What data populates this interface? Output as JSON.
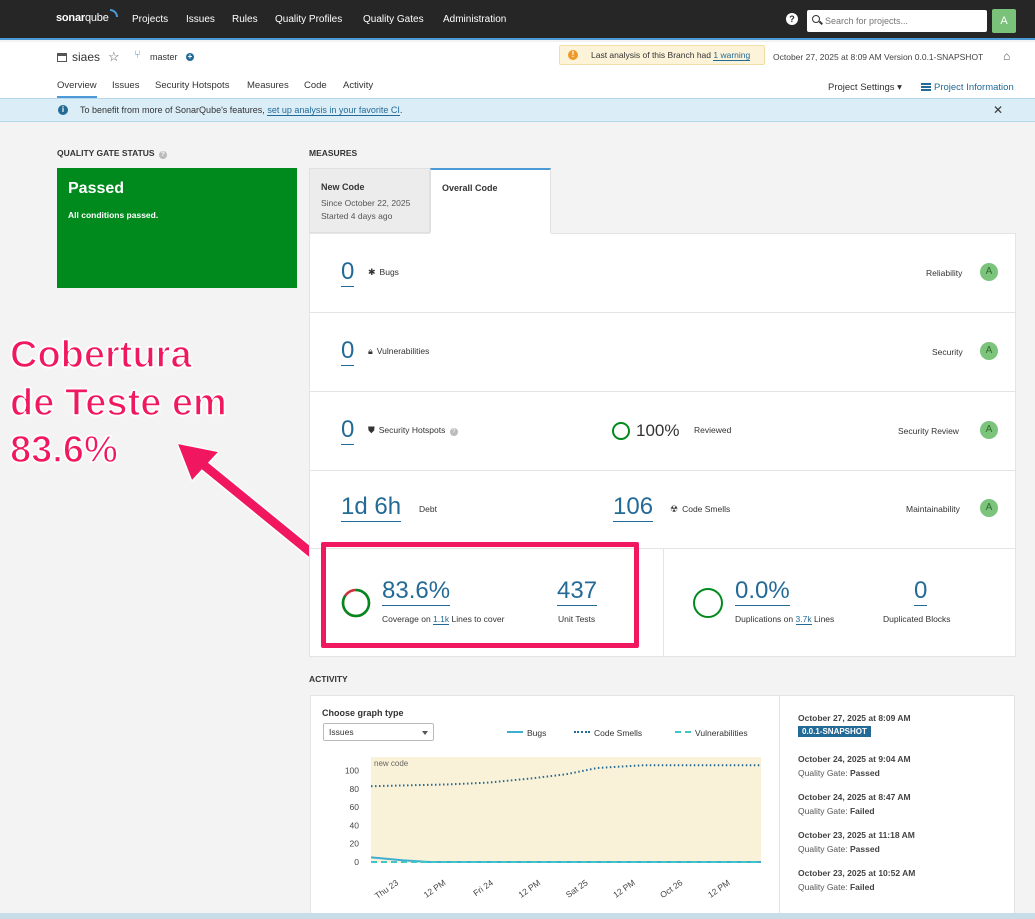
{
  "nav": {
    "logo_bold": "sonar",
    "logo_rest": "qube",
    "links": [
      "Projects",
      "Issues",
      "Rules",
      "Quality Profiles",
      "Quality Gates",
      "Administration"
    ],
    "search_placeholder": "Search for projects...",
    "avatar": "A"
  },
  "project": {
    "name": "siaes",
    "branch": "master",
    "warning_prefix": "Last analysis of this Branch had",
    "warning_link": "1 warning",
    "analysis": "October 27, 2025 at 8:09 AM  Version 0.0.1-SNAPSHOT",
    "tabs": [
      "Overview",
      "Issues",
      "Security Hotspots",
      "Measures",
      "Code",
      "Activity"
    ],
    "settings": "Project Settings ▾",
    "info": "Project Information"
  },
  "banner": {
    "text": "To benefit from more of SonarQube's features,",
    "link": "set up analysis in your favorite CI",
    "suffix": "."
  },
  "quality_gate": {
    "title": "QUALITY GATE STATUS",
    "status": "Passed",
    "subtitle": "All conditions passed."
  },
  "measures": {
    "title": "MEASURES",
    "new_code": {
      "label": "New Code",
      "since": "Since October 22, 2025",
      "started": "Started 4 days ago"
    },
    "overall_code": {
      "label": "Overall Code"
    },
    "bugs": {
      "value": "0",
      "label": "Bugs",
      "rating_label": "Reliability",
      "rating": "A"
    },
    "vulnerabilities": {
      "value": "0",
      "label": "Vulnerabilities",
      "rating_label": "Security",
      "rating": "A"
    },
    "hotspots": {
      "value": "0",
      "label": "Security Hotspots",
      "reviewed_value": "100%",
      "reviewed_label": "Reviewed",
      "rating_label": "Security Review",
      "rating": "A"
    },
    "maintainability": {
      "debt_value": "1d 6h",
      "debt_label": "Debt",
      "smells_value": "106",
      "smells_label": "Code Smells",
      "rating_label": "Maintainability",
      "rating": "A"
    },
    "coverage": {
      "value": "83.6%",
      "fraction": 0.836,
      "label_prefix": "Coverage on",
      "lines": "1.1k",
      "label_suffix": "Lines to cover",
      "tests_value": "437",
      "tests_label": "Unit Tests"
    },
    "duplications": {
      "value": "0.0%",
      "label_prefix": "Duplications on",
      "lines": "3.7k",
      "label_suffix": "Lines",
      "blocks_value": "0",
      "blocks_label": "Duplicated Blocks"
    }
  },
  "annotation": {
    "line1": "Cobertura",
    "line2": "de Teste em",
    "line3": "83.6%"
  },
  "activity": {
    "title": "ACTIVITY",
    "graph_label": "Choose graph type",
    "graph_type": "Issues",
    "new_code_label": "new code",
    "colors": {
      "bugs": "#3daed2",
      "smells": "#236a97",
      "vulnerabilities": "#3fc7c8",
      "new_code_bg": "#faf2d8"
    },
    "events": [
      {
        "date": "October 27, 2025 at 8:09 AM",
        "badge": "0.0.1-SNAPSHOT"
      },
      {
        "date": "October 24, 2025 at 9:04 AM",
        "gate_prefix": "Quality Gate:",
        "gate": "Passed"
      },
      {
        "date": "October 24, 2025 at 8:47 AM",
        "gate_prefix": "Quality Gate:",
        "gate": "Failed"
      },
      {
        "date": "October 23, 2025 at 11:18 AM",
        "gate_prefix": "Quality Gate:",
        "gate": "Passed"
      },
      {
        "date": "October 23, 2025 at 10:52 AM",
        "gate_prefix": "Quality Gate:",
        "gate": "Failed"
      }
    ]
  },
  "chart_data": {
    "type": "line",
    "x": [
      "Thu 23",
      "12 PM",
      "Fri 24",
      "12 PM",
      "Sat 25",
      "12 PM",
      "Oct 26",
      "12 PM"
    ],
    "yticks": [
      0,
      20,
      40,
      60,
      80,
      100
    ],
    "ylim": [
      0,
      115
    ],
    "series": [
      {
        "name": "Bugs",
        "style": "solid",
        "points": [
          [
            0,
            5
          ],
          [
            0.08,
            2
          ],
          [
            0.15,
            0
          ],
          [
            0.35,
            0
          ],
          [
            0.55,
            0
          ],
          [
            0.75,
            0
          ],
          [
            1.0,
            0
          ]
        ]
      },
      {
        "name": "Code Smells",
        "style": "dotted",
        "points": [
          [
            0,
            83
          ],
          [
            0.1,
            84
          ],
          [
            0.2,
            85
          ],
          [
            0.3,
            87
          ],
          [
            0.4,
            91
          ],
          [
            0.5,
            96
          ],
          [
            0.58,
            103
          ],
          [
            0.7,
            106
          ],
          [
            0.85,
            106
          ],
          [
            1.0,
            106
          ]
        ]
      },
      {
        "name": "Vulnerabilities",
        "style": "dashed",
        "points": [
          [
            0,
            0
          ],
          [
            0.1,
            0
          ],
          [
            0.2,
            0
          ],
          [
            0.4,
            0
          ],
          [
            0.6,
            0
          ],
          [
            0.8,
            0
          ],
          [
            1.0,
            0
          ]
        ]
      }
    ]
  }
}
